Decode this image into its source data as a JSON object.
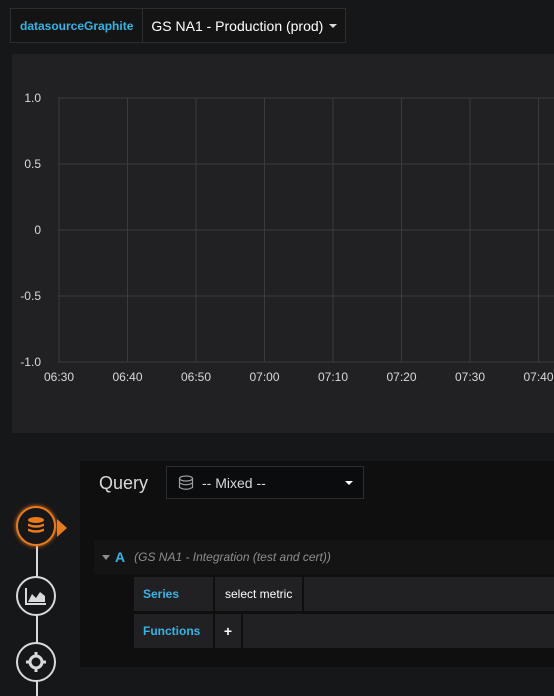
{
  "variable": {
    "label": "datasourceGraphite",
    "value": "GS NA1 - Production (prod)"
  },
  "chart_data": {
    "type": "line",
    "series": [],
    "y_ticks": [
      "1.0",
      "0.5",
      "0",
      "-0.5",
      "-1.0"
    ],
    "x_ticks": [
      "06:30",
      "06:40",
      "06:50",
      "07:00",
      "07:10",
      "07:20",
      "07:30",
      "07:40"
    ],
    "ylim": [
      -1,
      1
    ],
    "grid": true,
    "title": "",
    "xlabel": "",
    "ylabel": ""
  },
  "editor": {
    "title": "Query",
    "datasource_select": "-- Mixed --",
    "query": {
      "ref_id": "A",
      "datasource": "(GS NA1 - Integration (test and cert))",
      "series_label": "Series",
      "series_value": "select metric",
      "functions_label": "Functions",
      "add_function": "+"
    }
  },
  "sidebar": {
    "items": [
      {
        "icon": "database-icon",
        "active": true
      },
      {
        "icon": "chart-icon",
        "active": false
      },
      {
        "icon": "gear-icon",
        "active": false
      }
    ]
  },
  "colors": {
    "accent": "#33b5e5",
    "active": "#eb7b18",
    "panel": "#212124",
    "background": "#161719"
  }
}
